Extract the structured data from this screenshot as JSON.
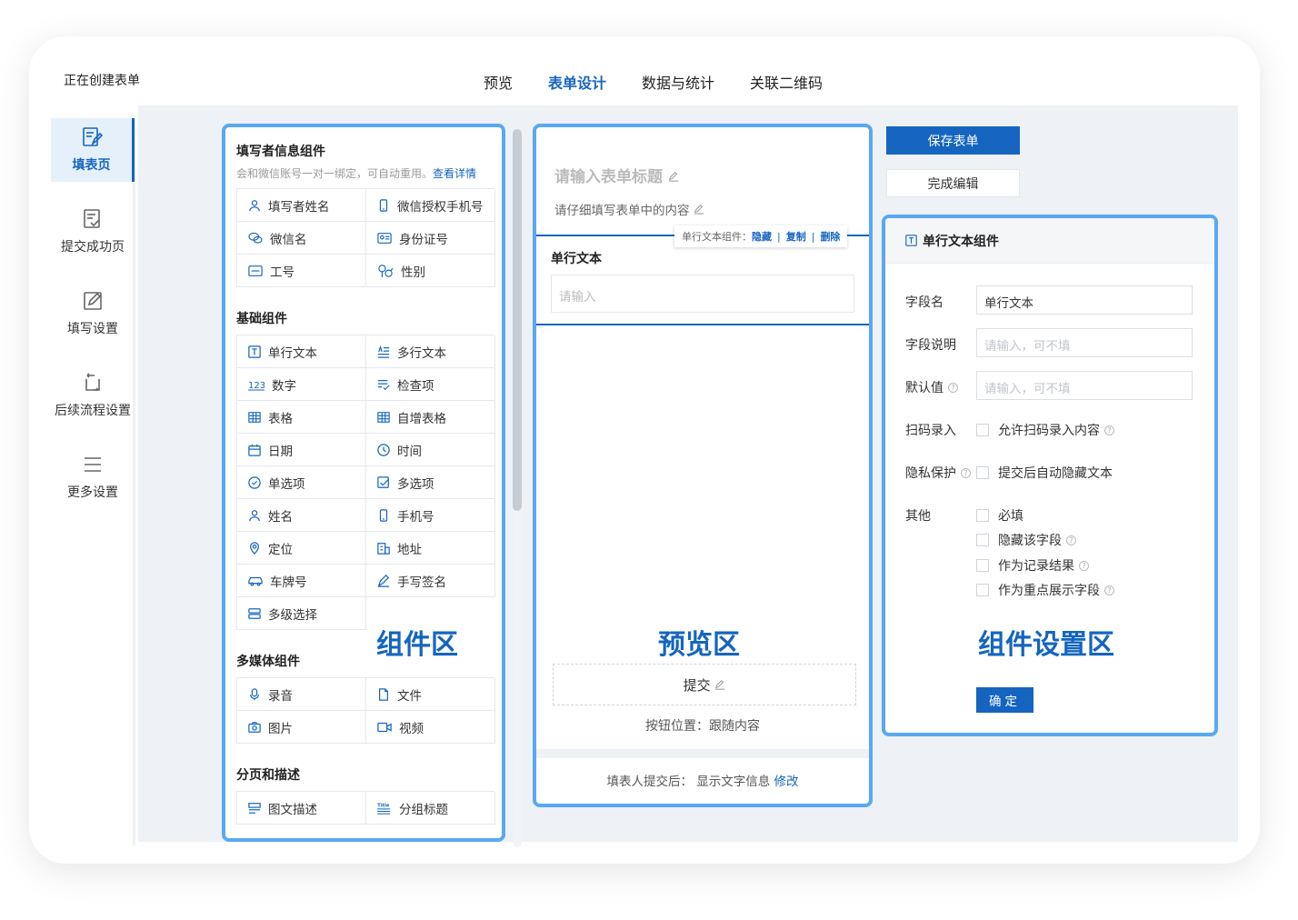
{
  "header": {
    "creating_label": "正在创建表单",
    "tabs": [
      {
        "label": "预览",
        "active": false
      },
      {
        "label": "表单设计",
        "active": true
      },
      {
        "label": "数据与统计",
        "active": false
      },
      {
        "label": "关联二维码",
        "active": false
      }
    ]
  },
  "sidebar": {
    "items": [
      {
        "label": "填表页",
        "icon": "form-edit-icon",
        "active": true
      },
      {
        "label": "提交成功页",
        "icon": "success-doc-icon",
        "active": false
      },
      {
        "label": "填写设置",
        "icon": "edit-settings-icon",
        "active": false
      },
      {
        "label": "后续流程设置",
        "icon": "flow-icon",
        "active": false
      },
      {
        "label": "更多设置",
        "icon": "menu-icon",
        "active": false
      }
    ]
  },
  "components": {
    "filler": {
      "title": "填写者信息组件",
      "subtitle": "会和微信账号一对一绑定，可自动重用。",
      "link": "查看详情",
      "items": [
        {
          "label": "填写者姓名",
          "icon": "user-icon"
        },
        {
          "label": "微信授权手机号",
          "icon": "phone-icon"
        },
        {
          "label": "微信名",
          "icon": "wechat-icon"
        },
        {
          "label": "身份证号",
          "icon": "id-card-icon"
        },
        {
          "label": "工号",
          "icon": "badge-icon"
        },
        {
          "label": "性别",
          "icon": "gender-icon"
        }
      ]
    },
    "basic": {
      "title": "基础组件",
      "items": [
        {
          "label": "单行文本",
          "icon": "text-icon"
        },
        {
          "label": "多行文本",
          "icon": "multiline-icon"
        },
        {
          "label": "数字",
          "icon": "number-icon"
        },
        {
          "label": "检查项",
          "icon": "checklist-icon"
        },
        {
          "label": "表格",
          "icon": "table-icon"
        },
        {
          "label": "自增表格",
          "icon": "table-plus-icon"
        },
        {
          "label": "日期",
          "icon": "calendar-icon"
        },
        {
          "label": "时间",
          "icon": "clock-icon"
        },
        {
          "label": "单选项",
          "icon": "radio-icon"
        },
        {
          "label": "多选项",
          "icon": "checkbox-icon"
        },
        {
          "label": "姓名",
          "icon": "user-icon"
        },
        {
          "label": "手机号",
          "icon": "phone-icon"
        },
        {
          "label": "定位",
          "icon": "location-icon"
        },
        {
          "label": "地址",
          "icon": "address-icon"
        },
        {
          "label": "车牌号",
          "icon": "car-icon"
        },
        {
          "label": "手写签名",
          "icon": "signature-icon"
        },
        {
          "label": "多级选择",
          "icon": "cascade-icon"
        }
      ]
    },
    "media": {
      "title": "多媒体组件",
      "items": [
        {
          "label": "录音",
          "icon": "mic-icon"
        },
        {
          "label": "文件",
          "icon": "file-icon"
        },
        {
          "label": "图片",
          "icon": "camera-icon"
        },
        {
          "label": "视频",
          "icon": "video-icon"
        }
      ]
    },
    "paging": {
      "title": "分页和描述",
      "items": [
        {
          "label": "图文描述",
          "icon": "image-text-icon"
        },
        {
          "label": "分组标题",
          "icon": "title-icon"
        }
      ]
    },
    "zone_label": "组件区"
  },
  "preview": {
    "title_placeholder": "请输入表单标题",
    "desc": "请仔细填写表单中的内容",
    "toolbar": {
      "prefix": "单行文本组件：",
      "hide": "隐藏",
      "copy": "复制",
      "delete": "删除"
    },
    "field_label": "单行文本",
    "field_placeholder": "请输入",
    "zone_label": "预览区",
    "submit_label": "提交",
    "button_position": "按钮位置：跟随内容",
    "footer_text": "填表人提交后：  显示文字信息",
    "footer_link": "修改"
  },
  "actions": {
    "save": "保存表单",
    "done": "完成编辑"
  },
  "settings": {
    "header": "单行文本组件",
    "field_name_label": "字段名",
    "field_name_value": "单行文本",
    "field_desc_label": "字段说明",
    "field_desc_placeholder": "请输入，可不填",
    "default_label": "默认值",
    "default_placeholder": "请输入，可不填",
    "scan_label": "扫码录入",
    "scan_option": "允许扫码录入内容",
    "privacy_label": "隐私保护",
    "privacy_option": "提交后自动隐藏文本",
    "other_label": "其他",
    "other_options": [
      "必填",
      "隐藏该字段",
      "作为记录结果",
      "作为重点展示字段"
    ],
    "zone_label": "组件设置区",
    "ok_button": "确定"
  },
  "colors": {
    "accent": "#1565c0",
    "zone_border": "#5aa8f2",
    "workspace_bg": "#eef1f5"
  }
}
